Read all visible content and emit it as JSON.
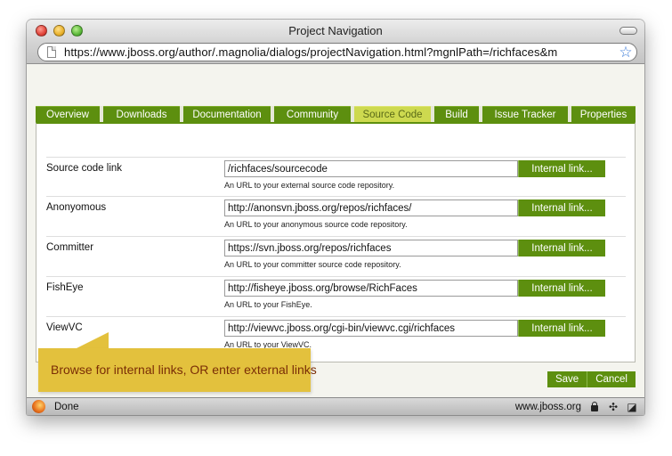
{
  "window": {
    "title": "Project Navigation"
  },
  "address_bar": {
    "url": "https://www.jboss.org/author/.magnolia/dialogs/projectNavigation.html?mgnlPath=/richfaces&m"
  },
  "tabs": [
    {
      "label": "Overview",
      "active": false
    },
    {
      "label": "Downloads",
      "active": false
    },
    {
      "label": "Documentation",
      "active": false
    },
    {
      "label": "Community",
      "active": false
    },
    {
      "label": "Source Code",
      "active": true
    },
    {
      "label": "Build",
      "active": false
    },
    {
      "label": "Issue Tracker",
      "active": false
    },
    {
      "label": "Properties",
      "active": false
    }
  ],
  "fields": [
    {
      "label": "Source code link",
      "value": "/richfaces/sourcecode",
      "button": "Internal link...",
      "help": "An URL to your external source code repository."
    },
    {
      "label": "Anonyomous",
      "value": "http://anonsvn.jboss.org/repos/richfaces/",
      "button": "Internal link...",
      "help": "An URL to your anonymous source code repository."
    },
    {
      "label": "Committer",
      "value": "https://svn.jboss.org/repos/richfaces",
      "button": "Internal link...",
      "help": "An URL to your committer source code repository."
    },
    {
      "label": "FishEye",
      "value": "http://fisheye.jboss.org/browse/RichFaces",
      "button": "Internal link...",
      "help": "An URL to your FishEye."
    },
    {
      "label": "ViewVC",
      "value": "http://viewvc.jboss.org/cgi-bin/viewvc.cgi/richfaces",
      "button": "Internal link...",
      "help": "An URL to your ViewVC."
    }
  ],
  "footer": {
    "save_label": "Save",
    "cancel_label": "Cancel"
  },
  "status_bar": {
    "text": "Done",
    "domain": "www.jboss.org"
  },
  "callout": {
    "text": "Browse for internal links, OR enter external links"
  },
  "colors": {
    "accent": "#5d8f0f",
    "active_tab": "#cdd94f",
    "callout": "#e3c13d",
    "callout_text": "#7a2d06"
  },
  "icons": [
    "close-icon",
    "minimize-icon",
    "zoom-icon",
    "page-icon",
    "star-icon",
    "firefox-icon",
    "lock-icon",
    "debug-icon",
    "addon-icon"
  ]
}
